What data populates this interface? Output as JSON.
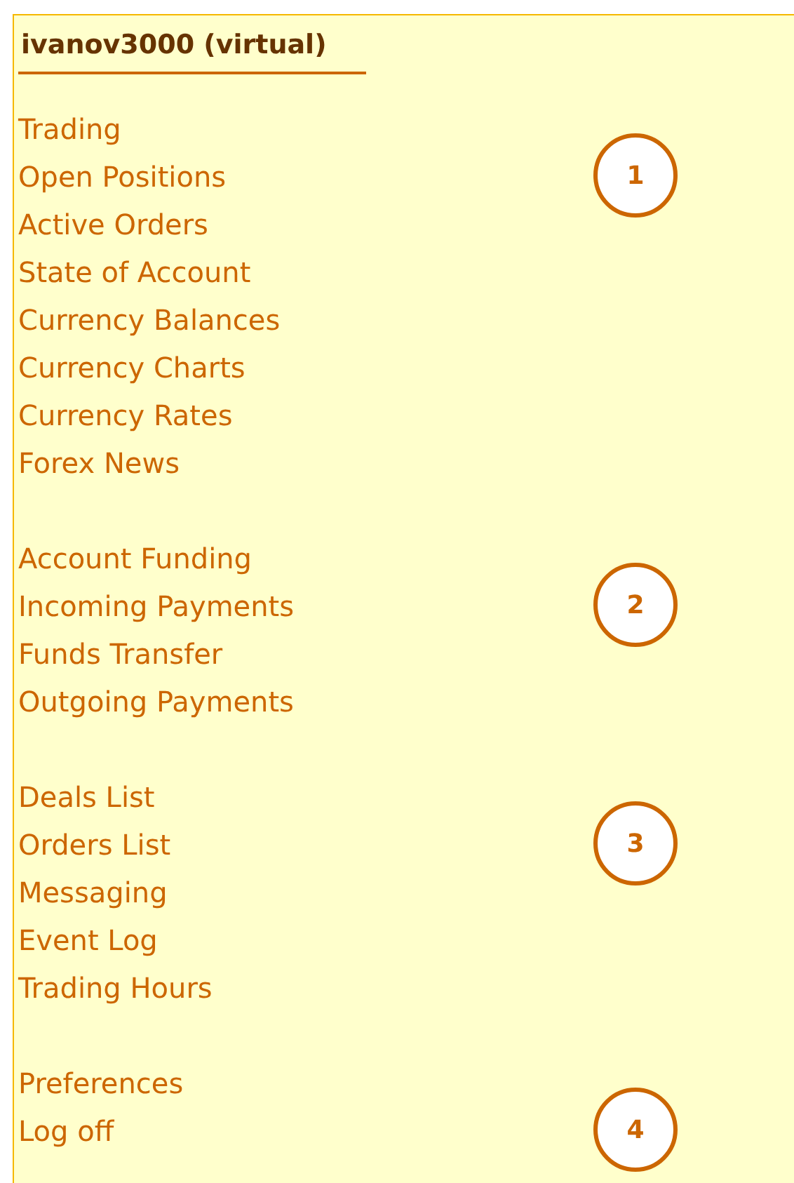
{
  "account_title": "ivanov3000 (virtual)",
  "menu_groups": [
    {
      "badge": "1",
      "items": [
        "Trading",
        "Open Positions",
        "Active Orders",
        "State of Account",
        "Currency Balances",
        "Currency Charts",
        "Currency Rates",
        "Forex News"
      ]
    },
    {
      "badge": "2",
      "items": [
        "Account Funding",
        "Incoming Payments",
        "Funds Transfer",
        "Outgoing Payments"
      ]
    },
    {
      "badge": "3",
      "items": [
        "Deals List",
        "Orders List",
        "Messaging",
        "Event Log",
        "Trading Hours"
      ]
    },
    {
      "badge": "4",
      "items": [
        "Preferences",
        "Log off"
      ]
    }
  ]
}
